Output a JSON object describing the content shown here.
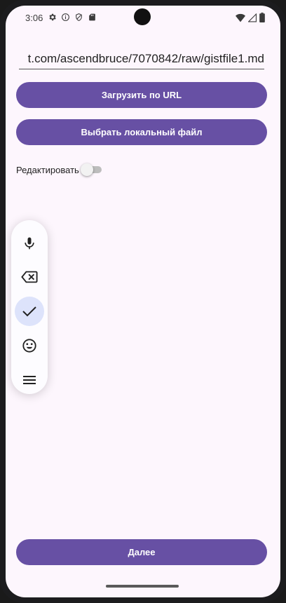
{
  "status_bar": {
    "time": "3:06",
    "left_icons": [
      "settings-icon",
      "info-icon",
      "shield-icon",
      "sd-card-icon"
    ],
    "right_icons": [
      "wifi-icon",
      "signal-icon",
      "battery-icon"
    ]
  },
  "url_field": {
    "value": "t.com/ascendbruce/7070842/raw/gistfile1.md"
  },
  "buttons": {
    "load_url": "Загрузить по URL",
    "choose_file": "Выбрать локальный файл",
    "next": "Далее"
  },
  "edit_toggle": {
    "label": "Редактировать",
    "enabled": false
  },
  "floating_toolbar": {
    "items": [
      "mic-icon",
      "backspace-icon",
      "check-icon",
      "emoji-icon",
      "menu-icon"
    ],
    "active_item": "check-icon"
  },
  "colors": {
    "primary": "#6750a4",
    "background": "#fdf6fd",
    "active_item_bg": "#dde3fb"
  }
}
